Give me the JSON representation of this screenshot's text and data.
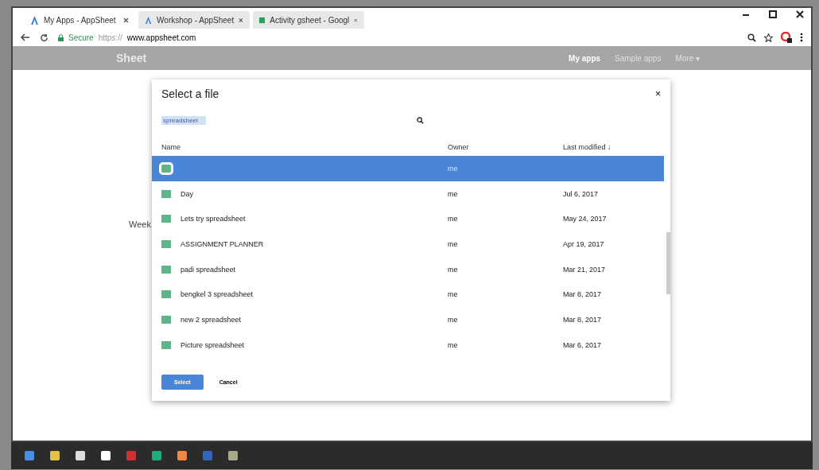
{
  "browser": {
    "tabs": [
      {
        "title": "My Apps - AppSheet",
        "selected": true,
        "kind": "appsheet"
      },
      {
        "title": "Workshop - AppSheet",
        "selected": false,
        "kind": "appsheet"
      },
      {
        "title": "Activity gsheet - Googl",
        "selected": false,
        "kind": "sheets"
      }
    ],
    "address": {
      "secure": "Secure",
      "scheme": "https://",
      "host": "www.appsheet.com"
    }
  },
  "site_nav": {
    "logo": "Sheet",
    "links": [
      {
        "label": "My apps",
        "selected": true
      },
      {
        "label": "Sample apps",
        "selected": false
      },
      {
        "label": "More ▾",
        "selected": false
      }
    ]
  },
  "background_text": "Week",
  "dialog": {
    "title": "Select a file",
    "close": "×",
    "search": {
      "value": "spreadsheet"
    },
    "columns": [
      "Name",
      "Owner",
      "Last modified ↓"
    ],
    "rows": [
      {
        "owner": "me",
        "selected": true
      },
      {
        "name": "Day",
        "owner": "me",
        "modified": "Jul 6, 2017",
        "selected": false
      },
      {
        "name": "Lets try spreadsheet",
        "owner": "me",
        "modified": "May 24, 2017",
        "selected": false
      },
      {
        "name": "ASSIGNMENT PLANNER",
        "owner": "me",
        "modified": "Apr 19, 2017",
        "selected": false
      },
      {
        "name": "padi spreadsheet",
        "owner": "me",
        "modified": "Mar 21, 2017",
        "selected": false
      },
      {
        "name": "bengkel 3 spreadsheet",
        "owner": "me",
        "modified": "Mar 8, 2017",
        "selected": false
      },
      {
        "name": "new 2 spreadsheet",
        "owner": "me",
        "modified": "Mar 8, 2017",
        "selected": false
      },
      {
        "name": "Picture spreadsheet",
        "owner": "me",
        "modified": "Mar 6, 2017",
        "selected": false
      }
    ],
    "buttons": [
      "Select",
      "Cancel"
    ]
  }
}
